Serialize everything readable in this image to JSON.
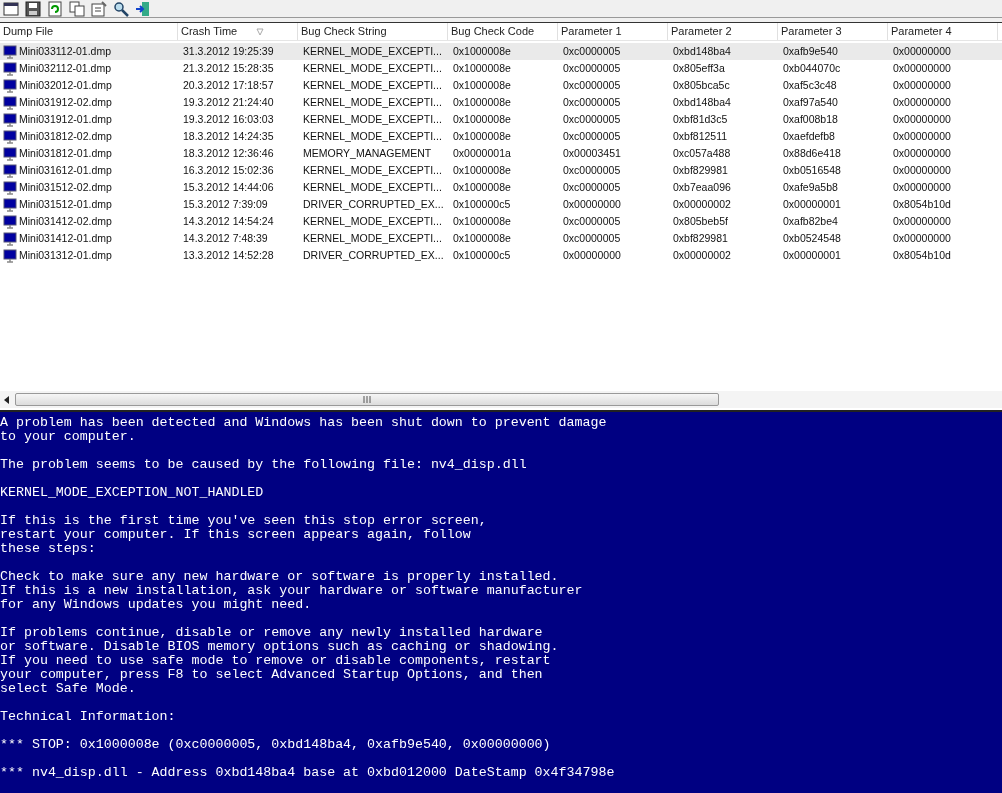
{
  "table": {
    "columns": [
      {
        "label": "Dump File",
        "sorted": false
      },
      {
        "label": "Crash Time",
        "sorted": true
      },
      {
        "label": "Bug Check String",
        "sorted": false
      },
      {
        "label": "Bug Check Code",
        "sorted": false
      },
      {
        "label": "Parameter 1",
        "sorted": false
      },
      {
        "label": "Parameter 2",
        "sorted": false
      },
      {
        "label": "Parameter 3",
        "sorted": false
      },
      {
        "label": "Parameter 4",
        "sorted": false
      }
    ],
    "rows": [
      {
        "selected": true,
        "cells": [
          "Mini033112-01.dmp",
          "31.3.2012 19:25:39",
          "KERNEL_MODE_EXCEPTI...",
          "0x1000008e",
          "0xc0000005",
          "0xbd148ba4",
          "0xafb9e540",
          "0x00000000"
        ]
      },
      {
        "selected": false,
        "cells": [
          "Mini032112-01.dmp",
          "21.3.2012 15:28:35",
          "KERNEL_MODE_EXCEPTI...",
          "0x1000008e",
          "0xc0000005",
          "0x805eff3a",
          "0xb044070c",
          "0x00000000"
        ]
      },
      {
        "selected": false,
        "cells": [
          "Mini032012-01.dmp",
          "20.3.2012 17:18:57",
          "KERNEL_MODE_EXCEPTI...",
          "0x1000008e",
          "0xc0000005",
          "0x805bca5c",
          "0xaf5c3c48",
          "0x00000000"
        ]
      },
      {
        "selected": false,
        "cells": [
          "Mini031912-02.dmp",
          "19.3.2012 21:24:40",
          "KERNEL_MODE_EXCEPTI...",
          "0x1000008e",
          "0xc0000005",
          "0xbd148ba4",
          "0xaf97a540",
          "0x00000000"
        ]
      },
      {
        "selected": false,
        "cells": [
          "Mini031912-01.dmp",
          "19.3.2012 16:03:03",
          "KERNEL_MODE_EXCEPTI...",
          "0x1000008e",
          "0xc0000005",
          "0xbf81d3c5",
          "0xaf008b18",
          "0x00000000"
        ]
      },
      {
        "selected": false,
        "cells": [
          "Mini031812-02.dmp",
          "18.3.2012 14:24:35",
          "KERNEL_MODE_EXCEPTI...",
          "0x1000008e",
          "0xc0000005",
          "0xbf812511",
          "0xaefdefb8",
          "0x00000000"
        ]
      },
      {
        "selected": false,
        "cells": [
          "Mini031812-01.dmp",
          "18.3.2012 12:36:46",
          "MEMORY_MANAGEMENT",
          "0x0000001a",
          "0x00003451",
          "0xc057a488",
          "0x88d6e418",
          "0x00000000"
        ]
      },
      {
        "selected": false,
        "cells": [
          "Mini031612-01.dmp",
          "16.3.2012 15:02:36",
          "KERNEL_MODE_EXCEPTI...",
          "0x1000008e",
          "0xc0000005",
          "0xbf829981",
          "0xb0516548",
          "0x00000000"
        ]
      },
      {
        "selected": false,
        "cells": [
          "Mini031512-02.dmp",
          "15.3.2012 14:44:06",
          "KERNEL_MODE_EXCEPTI...",
          "0x1000008e",
          "0xc0000005",
          "0xb7eaa096",
          "0xafe9a5b8",
          "0x00000000"
        ]
      },
      {
        "selected": false,
        "cells": [
          "Mini031512-01.dmp",
          "15.3.2012 7:39:09",
          "DRIVER_CORRUPTED_EX...",
          "0x100000c5",
          "0x00000000",
          "0x00000002",
          "0x00000001",
          "0x8054b10d"
        ]
      },
      {
        "selected": false,
        "cells": [
          "Mini031412-02.dmp",
          "14.3.2012 14:54:24",
          "KERNEL_MODE_EXCEPTI...",
          "0x1000008e",
          "0xc0000005",
          "0x805beb5f",
          "0xafb82be4",
          "0x00000000"
        ]
      },
      {
        "selected": false,
        "cells": [
          "Mini031412-01.dmp",
          "14.3.2012 7:48:39",
          "KERNEL_MODE_EXCEPTI...",
          "0x1000008e",
          "0xc0000005",
          "0xbf829981",
          "0xb0524548",
          "0x00000000"
        ]
      },
      {
        "selected": false,
        "cells": [
          "Mini031312-01.dmp",
          "13.3.2012 14:52:28",
          "DRIVER_CORRUPTED_EX...",
          "0x100000c5",
          "0x00000000",
          "0x00000002",
          "0x00000001",
          "0x8054b10d"
        ]
      }
    ]
  },
  "blue_screen": {
    "paragraphs": [
      "A problem has been detected and Windows has been shut down to prevent damage\nto your computer.",
      "The problem seems to be caused by the following file: nv4_disp.dll",
      "KERNEL_MODE_EXCEPTION_NOT_HANDLED",
      "If this is the first time you've seen this stop error screen,\nrestart your computer. If this screen appears again, follow\nthese steps:",
      "Check to make sure any new hardware or software is properly installed.\nIf this is a new installation, ask your hardware or software manufacturer\nfor any Windows updates you might need.",
      "If problems continue, disable or remove any newly installed hardware\nor software. Disable BIOS memory options such as caching or shadowing.\nIf you need to use safe mode to remove or disable components, restart\nyour computer, press F8 to select Advanced Startup Options, and then\nselect Safe Mode.",
      "Technical Information:",
      "*** STOP: 0x1000008e (0xc0000005, 0xbd148ba4, 0xafb9e540, 0x00000000)",
      "*** nv4_disp.dll - Address 0xbd148ba4 base at 0xbd012000 DateStamp 0x4f34798e"
    ]
  }
}
